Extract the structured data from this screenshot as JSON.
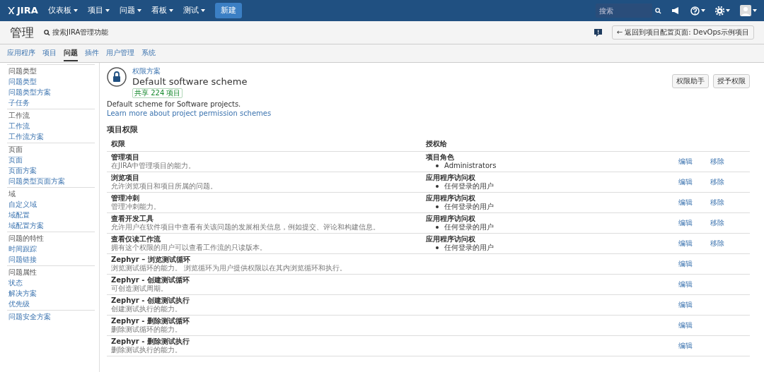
{
  "top_nav": {
    "logo": "JIRA",
    "menus": [
      {
        "label": "仪表板"
      },
      {
        "label": "项目"
      },
      {
        "label": "问题"
      },
      {
        "label": "看板"
      },
      {
        "label": "测试"
      }
    ],
    "create_button": "新建",
    "search": {
      "placeholder": "搜索"
    }
  },
  "header": {
    "title": "管理",
    "admin_search": "搜索JIRA管理功能",
    "back_button": "← 返回到项目配置页面: DevOps示例项目"
  },
  "admin_tabs": [
    {
      "label": "应用程序",
      "selected": false
    },
    {
      "label": "项目",
      "selected": false
    },
    {
      "label": "问题",
      "selected": true
    },
    {
      "label": "插件",
      "selected": false
    },
    {
      "label": "用户管理",
      "selected": false
    },
    {
      "label": "系统",
      "selected": false
    }
  ],
  "sidebar": {
    "sections": [
      {
        "heading": "问题类型",
        "items": [
          "问题类型",
          "问题类型方案",
          "子任务"
        ]
      },
      {
        "heading": "工作流",
        "items": [
          "工作流",
          "工作流方案"
        ]
      },
      {
        "heading": "页面",
        "items": [
          "页面",
          "页面方案",
          "问题类型页面方案"
        ]
      },
      {
        "heading": "域",
        "items": [
          "自定义域",
          "域配置",
          "域配置方案"
        ]
      },
      {
        "heading": "问题的特性",
        "items": [
          "时间跟踪",
          "问题链接"
        ]
      },
      {
        "heading": "问题属性",
        "items": [
          "状态",
          "解决方案",
          "优先级"
        ]
      },
      {
        "items": [
          "问题安全方案"
        ]
      }
    ]
  },
  "scheme": {
    "breadcrumb": "权限方案",
    "title": "Default software scheme",
    "shared_badge": "共享 224 项目",
    "description": "Default scheme for Software projects.",
    "learn_more": "Learn more about project permission schemes",
    "buttons": [
      "权限助手",
      "授予权限"
    ]
  },
  "permissions": {
    "heading": "项目权限",
    "columns": [
      "权限",
      "授权给"
    ],
    "rows": [
      {
        "name": "管理项目",
        "description": "在JIRA中管理项目的能力。",
        "grant_type": "项目角色",
        "grantees": [
          "Administrators"
        ],
        "edit": "编辑",
        "remove": "移除"
      },
      {
        "name": "浏览项目",
        "description": "允许浏览项目和项目所属的问题。",
        "grant_type": "应用程序访问权",
        "grantees": [
          "任何登录的用户"
        ],
        "edit": "编辑",
        "remove": "移除"
      },
      {
        "name": "管理冲刺",
        "description": "管理冲刺能力。",
        "grant_type": "应用程序访问权",
        "grantees": [
          "任何登录的用户"
        ],
        "edit": "编辑",
        "remove": "移除"
      },
      {
        "name": "查看开发工具",
        "description": "允许用户在软件项目中查看有关该问题的发展相关信息，例如提交、评论和构建信息。",
        "grant_type": "应用程序访问权",
        "grantees": [
          "任何登录的用户"
        ],
        "edit": "编辑",
        "remove": "移除"
      },
      {
        "name": "查看仅读工作流",
        "description": "拥有这个权限的用户可以查看工作流的只读版本。",
        "grant_type": "应用程序访问权",
        "grantees": [
          "任何登录的用户"
        ],
        "edit": "编辑",
        "remove": "移除"
      },
      {
        "name": "Zephyr – 浏览测试循环",
        "description": "浏览测试循环的能力。 浏览循环为用户提供权限以在其内浏览循环和执行。",
        "edit": "编辑"
      },
      {
        "name": "Zephyr - 创建测试循环",
        "description": "可创造测试周期。",
        "edit": "编辑"
      },
      {
        "name": "Zephyr - 创建测试执行",
        "description": "创建测试执行的能力。",
        "edit": "编辑"
      },
      {
        "name": "Zephyr - 删除测试循环",
        "description": "删除测试循环的能力。",
        "edit": "编辑"
      },
      {
        "name": "Zephyr - 删除测试执行",
        "description": "删除测试执行的能力。",
        "edit": "编辑"
      }
    ]
  }
}
